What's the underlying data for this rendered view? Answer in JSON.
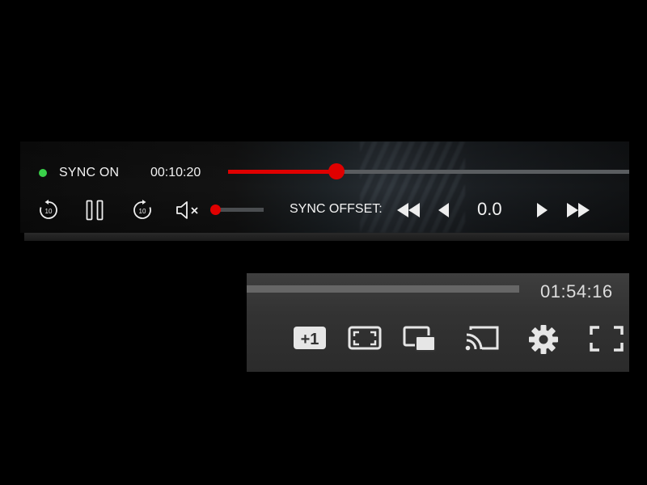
{
  "top_player": {
    "sync_status": "SYNC ON",
    "sync_status_color": "#3ad14a",
    "current_time": "00:10:20",
    "seek_progress": 0.27,
    "accent_color": "#e00000",
    "rewind_label": "10",
    "forward_label": "10",
    "volume_level": 0.0,
    "muted": true,
    "sync_offset_label": "SYNC OFFSET:",
    "sync_offset_value": "0.0",
    "icons": [
      "rewind-10-icon",
      "pause-icon",
      "forward-10-icon",
      "volume-muted-icon",
      "fast-rewind-icon",
      "step-back-icon",
      "step-forward-icon",
      "fast-forward-icon"
    ]
  },
  "bottom_player": {
    "total_time": "01:54:16",
    "plus_one_label": "+1",
    "icons": [
      "plus-one-icon",
      "aspect-ratio-icon",
      "picture-in-picture-icon",
      "cast-icon",
      "settings-gear-icon",
      "fullscreen-icon"
    ]
  }
}
